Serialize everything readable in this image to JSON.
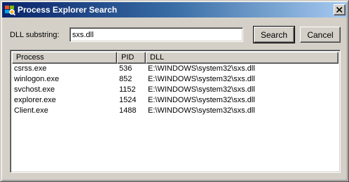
{
  "window": {
    "title": "Process Explorer Search",
    "icon": "process-explorer-app-icon"
  },
  "search": {
    "label": "DLL substring:",
    "value": "sxs.dll",
    "search_button": "Search",
    "cancel_button": "Cancel"
  },
  "results": {
    "columns": [
      "Process",
      "PID",
      "DLL"
    ],
    "rows": [
      {
        "process": "csrss.exe",
        "pid": "536",
        "dll": "E:\\WINDOWS\\system32\\sxs.dll"
      },
      {
        "process": "winlogon.exe",
        "pid": "852",
        "dll": "E:\\WINDOWS\\system32\\sxs.dll"
      },
      {
        "process": "svchost.exe",
        "pid": "1152",
        "dll": "E:\\WINDOWS\\system32\\sxs.dll"
      },
      {
        "process": "explorer.exe",
        "pid": "1524",
        "dll": "E:\\WINDOWS\\system32\\sxs.dll"
      },
      {
        "process": "Client.exe",
        "pid": "1488",
        "dll": "E:\\WINDOWS\\system32\\sxs.dll"
      }
    ]
  },
  "colors": {
    "titlebar_start": "#0a246a",
    "titlebar_end": "#a6caf0",
    "dialog_face": "#d4d0c8"
  }
}
